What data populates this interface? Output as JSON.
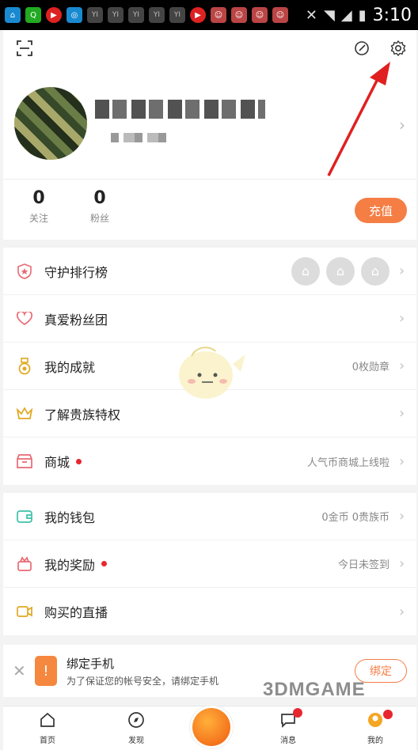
{
  "status_bar": {
    "time": "3:10"
  },
  "header": {
    "scan_icon": "scan-icon",
    "edit_icon": "edit-icon",
    "settings_icon": "gear-icon",
    "stats": [
      {
        "num": "0",
        "label": "关注"
      },
      {
        "num": "0",
        "label": "粉丝"
      }
    ],
    "recharge_label": "充值"
  },
  "menu_group_1": [
    {
      "label": "守护排行榜",
      "value": "",
      "dot": false
    },
    {
      "label": "真爱粉丝团",
      "value": "",
      "dot": false
    },
    {
      "label": "我的成就",
      "value": "0枚勋章",
      "dot": false
    },
    {
      "label": "了解贵族特权",
      "value": "",
      "dot": false
    },
    {
      "label": "商城",
      "value": "人气币商城上线啦",
      "dot": true
    }
  ],
  "menu_group_2": [
    {
      "label": "我的钱包",
      "value": "0金币 0贵族币",
      "dot": false
    },
    {
      "label": "我的奖励",
      "value": "今日未签到",
      "dot": true
    },
    {
      "label": "购买的直播",
      "value": "",
      "dot": false
    }
  ],
  "bind_phone": {
    "title": "绑定手机",
    "desc": "为了保证您的帐号安全，请绑定手机",
    "button": "绑定"
  },
  "tabbar": {
    "tabs": [
      {
        "label": "首页"
      },
      {
        "label": "发现"
      },
      {
        "label": "消息"
      },
      {
        "label": "我的"
      }
    ]
  },
  "watermark": "3DMGAME",
  "colors": {
    "accent": "#f57e45",
    "dot": "#e8262f",
    "arrow": "#e02020"
  }
}
